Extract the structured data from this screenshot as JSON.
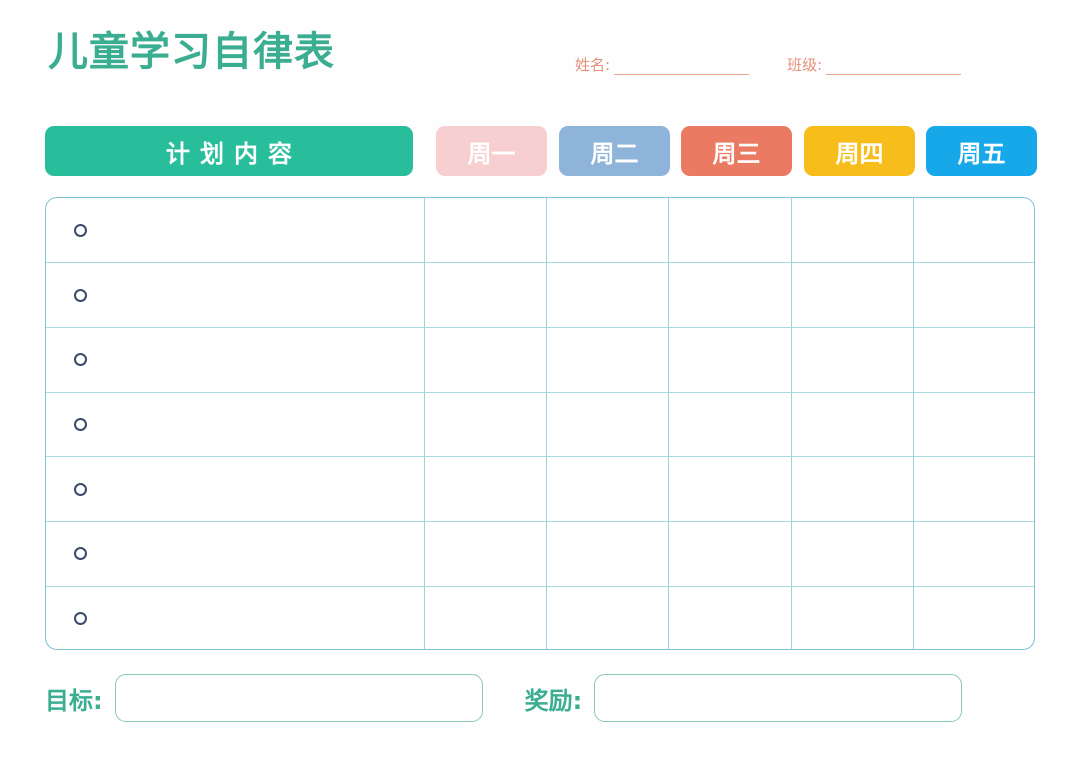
{
  "document": {
    "title": "儿童学习自律表",
    "title_color": "#3bae92",
    "background": "#fefefe"
  },
  "meta": {
    "fields": [
      {
        "label": "姓名:",
        "value": "",
        "name": "name-field"
      },
      {
        "label": "班级:",
        "value": "",
        "name": "class-field"
      }
    ],
    "label_color": "#e4917c",
    "line_color": "#e9a491"
  },
  "table": {
    "plan_header": {
      "label": "计划内容",
      "bg": "#28be9c",
      "text_color": "#ffffff"
    },
    "day_headers": [
      {
        "label": "周一",
        "bg": "#f8cfd0",
        "text_color": "#ffffff"
      },
      {
        "label": "周二",
        "bg": "#8fb4da",
        "text_color": "#ffffff"
      },
      {
        "label": "周三",
        "bg": "#eb7a63",
        "text_color": "#ffffff"
      },
      {
        "label": "周四",
        "bg": "#f7be1b",
        "text_color": "#ffffff"
      },
      {
        "label": "周五",
        "bg": "#16a8e8",
        "text_color": "#ffffff"
      }
    ],
    "row_count": 7,
    "rows": [
      {
        "plan": "",
        "days": [
          "",
          "",
          "",
          "",
          ""
        ]
      },
      {
        "plan": "",
        "days": [
          "",
          "",
          "",
          "",
          ""
        ]
      },
      {
        "plan": "",
        "days": [
          "",
          "",
          "",
          "",
          ""
        ]
      },
      {
        "plan": "",
        "days": [
          "",
          "",
          "",
          "",
          ""
        ]
      },
      {
        "plan": "",
        "days": [
          "",
          "",
          "",
          "",
          ""
        ]
      },
      {
        "plan": "",
        "days": [
          "",
          "",
          "",
          "",
          ""
        ]
      },
      {
        "plan": "",
        "days": [
          "",
          "",
          "",
          "",
          ""
        ]
      }
    ],
    "bullet_icon": "circle-outline-icon",
    "border_color": "#7cc3d6",
    "grid_color": "#a8dbe0"
  },
  "footer": {
    "goal": {
      "label": "目标:",
      "value": ""
    },
    "reward": {
      "label": "奖励:",
      "value": ""
    },
    "label_color": "#3bae92",
    "box_border_color": "#8ac7bd"
  }
}
